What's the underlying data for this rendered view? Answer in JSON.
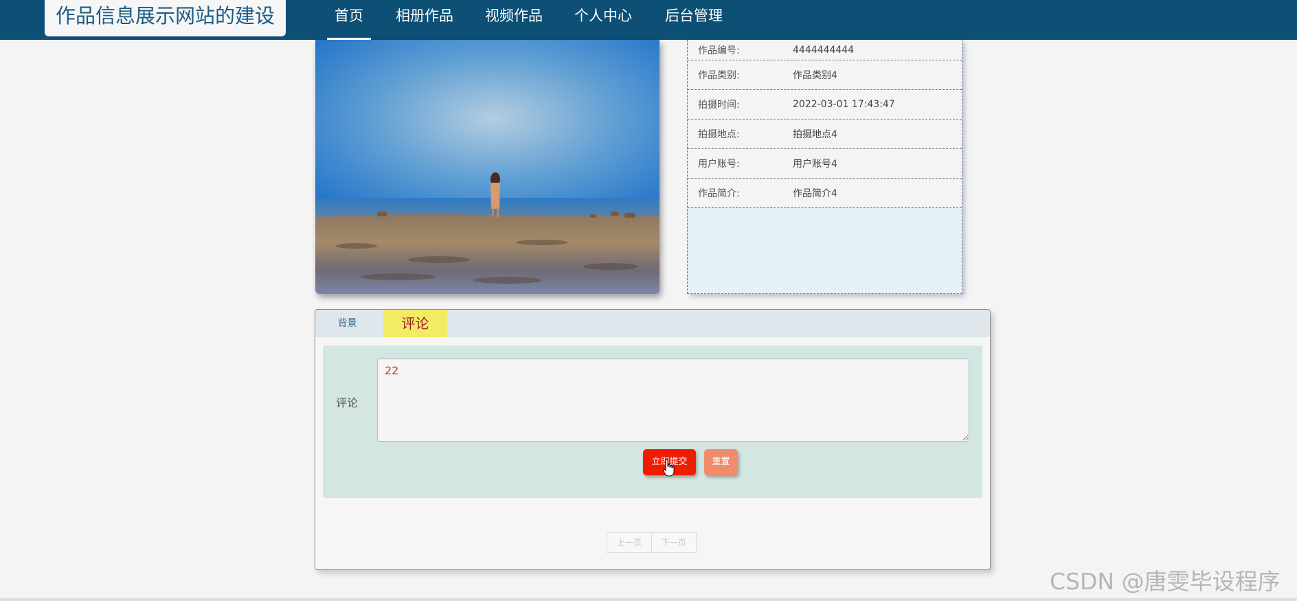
{
  "header": {
    "site_title": "作品信息展示网站的建设",
    "nav": [
      {
        "label": "首页",
        "active": true
      },
      {
        "label": "相册作品",
        "active": false
      },
      {
        "label": "视频作品",
        "active": false
      },
      {
        "label": "个人中心",
        "active": false
      },
      {
        "label": "后台管理",
        "active": false
      }
    ]
  },
  "work_info": {
    "rows": [
      {
        "label": "作品编号:",
        "value": "4444444444"
      },
      {
        "label": "作品类别:",
        "value": "作品类别4"
      },
      {
        "label": "拍摄时间:",
        "value": "2022-03-01 17:43:47"
      },
      {
        "label": "拍摄地点:",
        "value": "拍摄地点4"
      },
      {
        "label": "用户账号:",
        "value": "用户账号4"
      },
      {
        "label": "作品简介:",
        "value": "作品简介4"
      }
    ]
  },
  "detail_tabs": {
    "background_label": "背景",
    "comment_label": "评论"
  },
  "comment_form": {
    "label": "评论",
    "text_value": "22",
    "submit_label": "立即提交",
    "reset_label": "重置"
  },
  "pagination": {
    "prev_label": "上一页",
    "next_label": "下一页"
  },
  "watermark": "CSDN @唐雯毕设程序",
  "colors": {
    "nav_bg": "#0d4f75",
    "submit": "#f01c00",
    "reset": "#f08c6c",
    "active_tab": "#f2ec65"
  }
}
